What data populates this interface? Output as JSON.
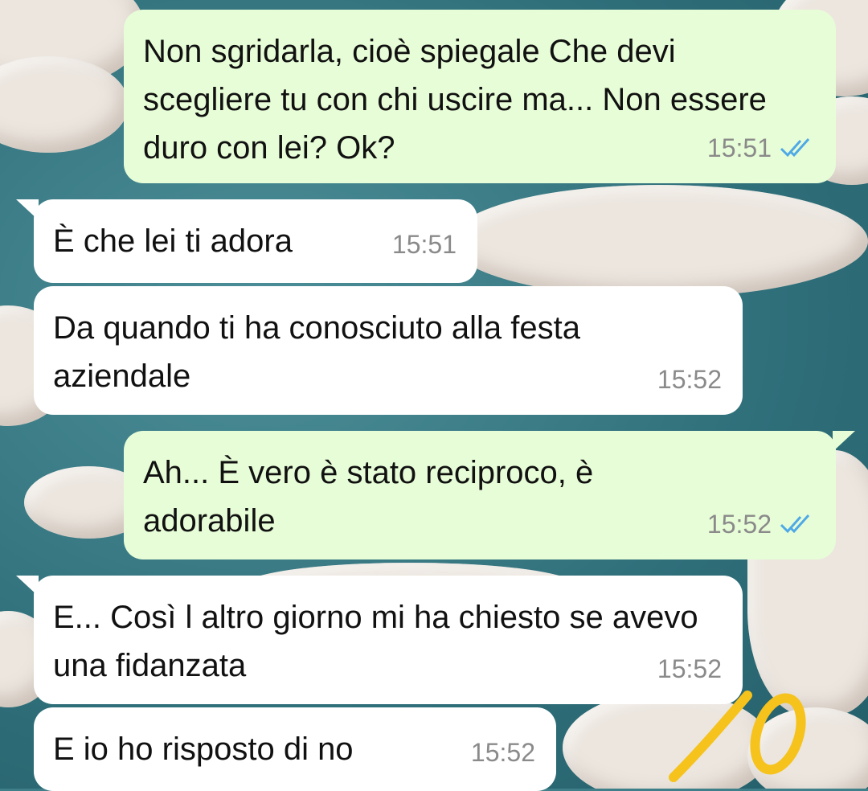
{
  "messages": [
    {
      "direction": "out",
      "text": "Non sgridarla, cioè spiegale Che devi scegliere tu con chi uscire ma... Non essere duro con lei? Ok?",
      "time": "15:51",
      "status": "read"
    },
    {
      "direction": "in",
      "text": "È che lei ti adora",
      "time": "15:51"
    },
    {
      "direction": "in",
      "text": "Da quando ti ha conosciuto alla festa aziendale",
      "time": "15:52"
    },
    {
      "direction": "out",
      "text": "Ah... È vero è stato reciproco, è adorabile",
      "time": "15:52",
      "status": "read"
    },
    {
      "direction": "in",
      "text": "E... Così l altro giorno mi ha chiesto se avevo una fidanzata",
      "time": "15:52"
    },
    {
      "direction": "in",
      "text": "E io ho risposto di no",
      "time": "15:52"
    }
  ],
  "annotation": {
    "text": "10",
    "color": "#f6c21c"
  },
  "colors": {
    "outgoing_bubble": "#e7fdd7",
    "incoming_bubble": "#ffffff",
    "read_ticks": "#4fa9e6",
    "timestamp": "#8a8a8a"
  }
}
